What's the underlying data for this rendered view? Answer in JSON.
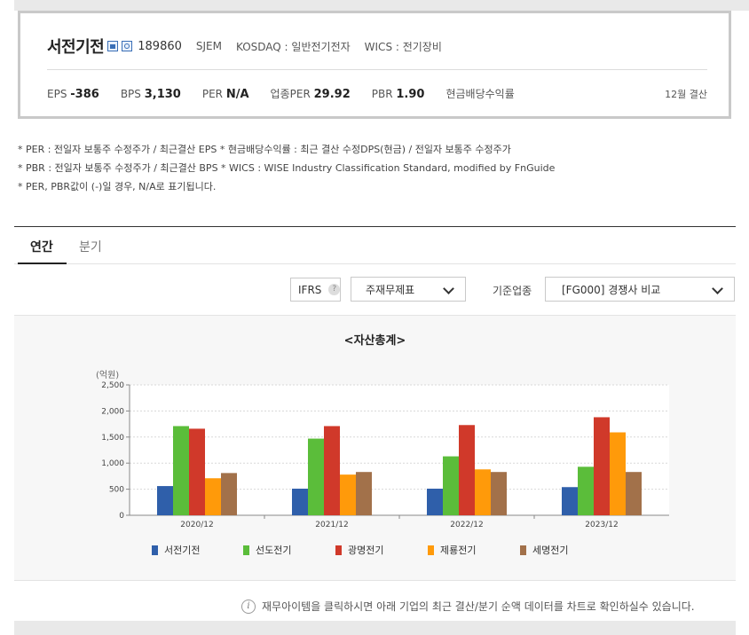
{
  "company": {
    "name": "서전기전",
    "code": "189860",
    "english_name": "SJEM",
    "market": "KOSDAQ : 일반전기전자",
    "wics": "WICS : 전기장비",
    "icon_a": "home-icon",
    "icon_b": "company-info-icon"
  },
  "stats": {
    "eps_label": "EPS",
    "eps_value": "-386",
    "bps_label": "BPS",
    "bps_value": "3,130",
    "per_label": "PER",
    "per_value": "N/A",
    "industry_per_label": "업종PER",
    "industry_per_value": "29.92",
    "pbr_label": "PBR",
    "pbr_value": "1.90",
    "dividend_label": "현금배당수익률",
    "settlement": "12월 결산"
  },
  "notes": [
    "* PER : 전일자 보통주 수정주가 / 최근결산 EPS * 현금배당수익률 : 최근 결산 수정DPS(현금) / 전일자 보통주 수정주가",
    "* PBR : 전일자 보통주 수정주가 / 최근결산 BPS * WICS : WISE Industry Classification Standard, modified by FnGuide",
    "* PER, PBR값이 (-)일 경우, N/A로 표기됩니다."
  ],
  "tabs": {
    "annual": "연간",
    "quarterly": "분기"
  },
  "controls": {
    "ifrs_label": "IFRS",
    "help": "?",
    "statement_select": "주재무제표",
    "standard_label": "기준업종",
    "industry_select": "[FG000] 경쟁사 비교"
  },
  "info_text": "재무아이템을 클릭하시면 아래 기업의 최근 결산/분기 순액 데이터를 차트로 확인하실수 있습니다.",
  "chart_data": {
    "type": "bar",
    "title": "<자산총계>",
    "unit": "(억원)",
    "categories": [
      "2020/12",
      "2021/12",
      "2022/12",
      "2023/12"
    ],
    "yticks": [
      "0",
      "500",
      "1,000",
      "1,500",
      "2,000",
      "2,500"
    ],
    "ylim": [
      0,
      2500
    ],
    "grid": true,
    "legend_position": "bottom",
    "series": [
      {
        "name": "서전기전",
        "color": "#2f5faa",
        "values": [
          560,
          510,
          510,
          540
        ]
      },
      {
        "name": "선도전기",
        "color": "#5bbd3a",
        "values": [
          1710,
          1470,
          1130,
          930
        ]
      },
      {
        "name": "광명전기",
        "color": "#d0392a",
        "values": [
          1660,
          1710,
          1730,
          1880
        ]
      },
      {
        "name": "제룡전기",
        "color": "#ff9a0a",
        "values": [
          710,
          780,
          880,
          1590
        ]
      },
      {
        "name": "세명전기",
        "color": "#a2714a",
        "values": [
          810,
          830,
          830,
          830
        ]
      }
    ]
  }
}
